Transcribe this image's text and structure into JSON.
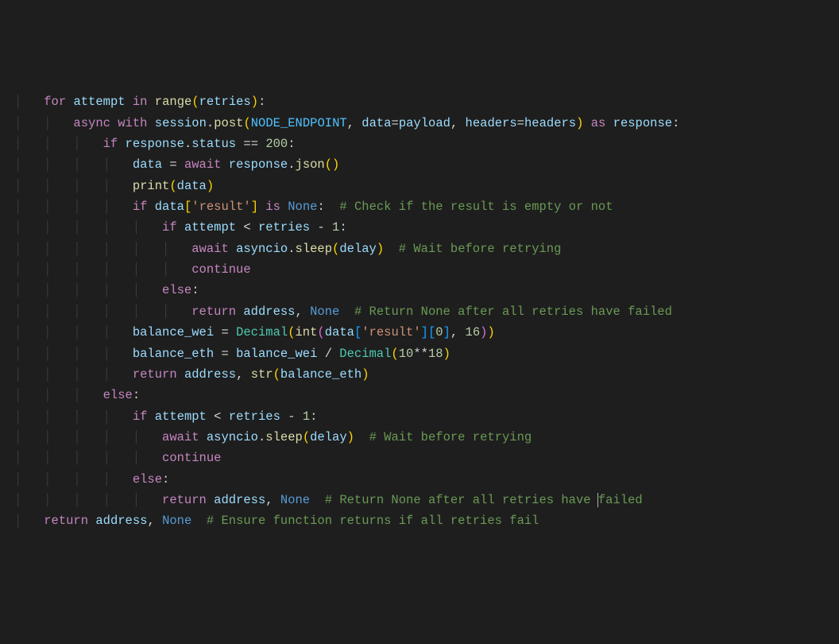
{
  "code": {
    "lines": [
      {
        "indent": 1,
        "tokens": [
          [
            "kw",
            "for"
          ],
          [
            "op",
            " "
          ],
          [
            "var",
            "attempt"
          ],
          [
            "op",
            " "
          ],
          [
            "kw",
            "in"
          ],
          [
            "op",
            " "
          ],
          [
            "fn",
            "range"
          ],
          [
            "paren",
            "("
          ],
          [
            "var",
            "retries"
          ],
          [
            "paren",
            ")"
          ],
          [
            "op",
            ":"
          ]
        ]
      },
      {
        "indent": 2,
        "tokens": [
          [
            "kw",
            "async"
          ],
          [
            "op",
            " "
          ],
          [
            "kw",
            "with"
          ],
          [
            "op",
            " "
          ],
          [
            "var",
            "session"
          ],
          [
            "op",
            "."
          ],
          [
            "fn",
            "post"
          ],
          [
            "paren",
            "("
          ],
          [
            "const",
            "NODE_ENDPOINT"
          ],
          [
            "op",
            ", "
          ],
          [
            "var",
            "data"
          ],
          [
            "op",
            "="
          ],
          [
            "var",
            "payload"
          ],
          [
            "op",
            ", "
          ],
          [
            "var",
            "headers"
          ],
          [
            "op",
            "="
          ],
          [
            "var",
            "headers"
          ],
          [
            "paren",
            ")"
          ],
          [
            "op",
            " "
          ],
          [
            "kw",
            "as"
          ],
          [
            "op",
            " "
          ],
          [
            "var",
            "response"
          ],
          [
            "op",
            ":"
          ]
        ]
      },
      {
        "indent": 3,
        "tokens": [
          [
            "kw",
            "if"
          ],
          [
            "op",
            " "
          ],
          [
            "var",
            "response"
          ],
          [
            "op",
            "."
          ],
          [
            "var",
            "status"
          ],
          [
            "op",
            " == "
          ],
          [
            "num",
            "200"
          ],
          [
            "op",
            ":"
          ]
        ]
      },
      {
        "indent": 4,
        "tokens": [
          [
            "var",
            "data"
          ],
          [
            "op",
            " = "
          ],
          [
            "kw",
            "await"
          ],
          [
            "op",
            " "
          ],
          [
            "var",
            "response"
          ],
          [
            "op",
            "."
          ],
          [
            "fn",
            "json"
          ],
          [
            "paren",
            "("
          ],
          [
            "paren",
            ")"
          ]
        ]
      },
      {
        "indent": 4,
        "tokens": [
          [
            "fn",
            "print"
          ],
          [
            "paren",
            "("
          ],
          [
            "var",
            "data"
          ],
          [
            "paren",
            ")"
          ]
        ]
      },
      {
        "indent": 4,
        "tokens": [
          [
            "kw",
            "if"
          ],
          [
            "op",
            " "
          ],
          [
            "var",
            "data"
          ],
          [
            "paren",
            "["
          ],
          [
            "str",
            "'result'"
          ],
          [
            "paren",
            "]"
          ],
          [
            "op",
            " "
          ],
          [
            "kw",
            "is"
          ],
          [
            "op",
            " "
          ],
          [
            "none",
            "None"
          ],
          [
            "op",
            ":  "
          ],
          [
            "cmt",
            "# Check if the result is empty or not"
          ]
        ]
      },
      {
        "indent": 5,
        "tokens": [
          [
            "kw",
            "if"
          ],
          [
            "op",
            " "
          ],
          [
            "var",
            "attempt"
          ],
          [
            "op",
            " < "
          ],
          [
            "var",
            "retries"
          ],
          [
            "op",
            " - "
          ],
          [
            "num",
            "1"
          ],
          [
            "op",
            ":"
          ]
        ]
      },
      {
        "indent": 6,
        "tokens": [
          [
            "kw",
            "await"
          ],
          [
            "op",
            " "
          ],
          [
            "var",
            "asyncio"
          ],
          [
            "op",
            "."
          ],
          [
            "fn",
            "sleep"
          ],
          [
            "paren",
            "("
          ],
          [
            "var",
            "delay"
          ],
          [
            "paren",
            ")"
          ],
          [
            "op",
            "  "
          ],
          [
            "cmt",
            "# Wait before retrying"
          ]
        ]
      },
      {
        "indent": 6,
        "tokens": [
          [
            "kw",
            "continue"
          ]
        ]
      },
      {
        "indent": 5,
        "tokens": [
          [
            "kw",
            "else"
          ],
          [
            "op",
            ":"
          ]
        ]
      },
      {
        "indent": 6,
        "tokens": [
          [
            "kw",
            "return"
          ],
          [
            "op",
            " "
          ],
          [
            "var",
            "address"
          ],
          [
            "op",
            ", "
          ],
          [
            "none",
            "None"
          ],
          [
            "op",
            "  "
          ],
          [
            "cmt",
            "# Return None after all retries have failed"
          ]
        ]
      },
      {
        "indent": 4,
        "tokens": [
          [
            "var",
            "balance_wei"
          ],
          [
            "op",
            " = "
          ],
          [
            "cls",
            "Decimal"
          ],
          [
            "paren",
            "("
          ],
          [
            "fn",
            "int"
          ],
          [
            "paren2",
            "("
          ],
          [
            "var",
            "data"
          ],
          [
            "paren3",
            "["
          ],
          [
            "str",
            "'result'"
          ],
          [
            "paren3",
            "]"
          ],
          [
            "paren3",
            "["
          ],
          [
            "num",
            "0"
          ],
          [
            "paren3",
            "]"
          ],
          [
            "op",
            ", "
          ],
          [
            "num",
            "16"
          ],
          [
            "paren2",
            ")"
          ],
          [
            "paren",
            ")"
          ]
        ]
      },
      {
        "indent": 4,
        "tokens": [
          [
            "var",
            "balance_eth"
          ],
          [
            "op",
            " = "
          ],
          [
            "var",
            "balance_wei"
          ],
          [
            "op",
            " / "
          ],
          [
            "cls",
            "Decimal"
          ],
          [
            "paren",
            "("
          ],
          [
            "num",
            "10"
          ],
          [
            "op",
            "**"
          ],
          [
            "num",
            "18"
          ],
          [
            "paren",
            ")"
          ]
        ]
      },
      {
        "indent": 4,
        "tokens": [
          [
            "kw",
            "return"
          ],
          [
            "op",
            " "
          ],
          [
            "var",
            "address"
          ],
          [
            "op",
            ", "
          ],
          [
            "fn",
            "str"
          ],
          [
            "paren",
            "("
          ],
          [
            "var",
            "balance_eth"
          ],
          [
            "paren",
            ")"
          ]
        ]
      },
      {
        "indent": 3,
        "tokens": [
          [
            "kw",
            "else"
          ],
          [
            "op",
            ":"
          ]
        ]
      },
      {
        "indent": 4,
        "tokens": [
          [
            "kw",
            "if"
          ],
          [
            "op",
            " "
          ],
          [
            "var",
            "attempt"
          ],
          [
            "op",
            " < "
          ],
          [
            "var",
            "retries"
          ],
          [
            "op",
            " - "
          ],
          [
            "num",
            "1"
          ],
          [
            "op",
            ":"
          ]
        ]
      },
      {
        "indent": 5,
        "tokens": [
          [
            "kw",
            "await"
          ],
          [
            "op",
            " "
          ],
          [
            "var",
            "asyncio"
          ],
          [
            "op",
            "."
          ],
          [
            "fn",
            "sleep"
          ],
          [
            "paren",
            "("
          ],
          [
            "var",
            "delay"
          ],
          [
            "paren",
            ")"
          ],
          [
            "op",
            "  "
          ],
          [
            "cmt",
            "# Wait before retrying"
          ]
        ]
      },
      {
        "indent": 5,
        "tokens": [
          [
            "kw",
            "continue"
          ]
        ]
      },
      {
        "indent": 4,
        "tokens": [
          [
            "kw",
            "else"
          ],
          [
            "op",
            ":"
          ]
        ]
      },
      {
        "indent": 5,
        "cursor": 44,
        "tokens": [
          [
            "kw",
            "return"
          ],
          [
            "op",
            " "
          ],
          [
            "var",
            "address"
          ],
          [
            "op",
            ", "
          ],
          [
            "none",
            "None"
          ],
          [
            "op",
            "  "
          ],
          [
            "cmt",
            "# Return None after all retries have "
          ],
          [
            "cursor",
            ""
          ],
          [
            "cmt",
            "failed"
          ]
        ]
      },
      {
        "indent": 1,
        "tokens": [
          [
            "kw",
            "return"
          ],
          [
            "op",
            " "
          ],
          [
            "var",
            "address"
          ],
          [
            "op",
            ", "
          ],
          [
            "none",
            "None"
          ],
          [
            "op",
            "  "
          ],
          [
            "cmt",
            "# Ensure function returns if all retries fail"
          ]
        ]
      }
    ]
  }
}
